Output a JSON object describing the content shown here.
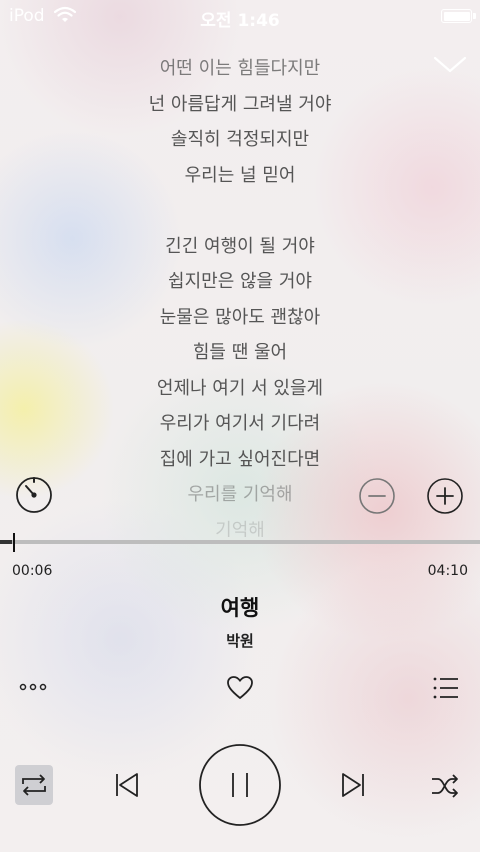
{
  "status_bar": {
    "carrier": "iPod",
    "time": "오전 1:46"
  },
  "lyrics": [
    {
      "text": "어떤 이는 힘들다지만",
      "opacity": 0.75
    },
    {
      "text": "넌 아름답게 그려낼 거야",
      "opacity": 1
    },
    {
      "text": "솔직히 걱정되지만",
      "opacity": 1
    },
    {
      "text": "우리는 널 믿어",
      "opacity": 1
    },
    {
      "text": "",
      "opacity": 1
    },
    {
      "text": "긴긴 여행이 될 거야",
      "opacity": 1
    },
    {
      "text": "쉽지만은 않을 거야",
      "opacity": 1
    },
    {
      "text": "눈물은 많아도 괜찮아",
      "opacity": 1
    },
    {
      "text": "힘들 땐 울어",
      "opacity": 1
    },
    {
      "text": "언제나 여기 서 있을게",
      "opacity": 1
    },
    {
      "text": "우리가 여기서 기다려",
      "opacity": 1
    },
    {
      "text": "집에 가고 싶어진다면",
      "opacity": 1
    },
    {
      "text": "우리를 기억해",
      "opacity": 0.45
    },
    {
      "text": "기억해",
      "opacity": 0.2
    }
  ],
  "playback": {
    "elapsed": "00:06",
    "duration": "04:10",
    "progress": 0.024
  },
  "track": {
    "title": "여행",
    "artist": "박원"
  },
  "icons": {
    "timer": "timer-icon",
    "minus": "minus-icon",
    "plus": "plus-icon",
    "more": "more-icon",
    "heart": "heart-icon",
    "playlist": "playlist-icon",
    "repeat": "repeat-icon",
    "previous": "previous-icon",
    "pause": "pause-icon",
    "next": "next-icon",
    "shuffle": "shuffle-icon",
    "collapse": "chevron-down-icon"
  },
  "colors": {
    "icon": "#222222",
    "status_text": "#ffffff",
    "repeat_active_bg": "#cfcfd3"
  }
}
